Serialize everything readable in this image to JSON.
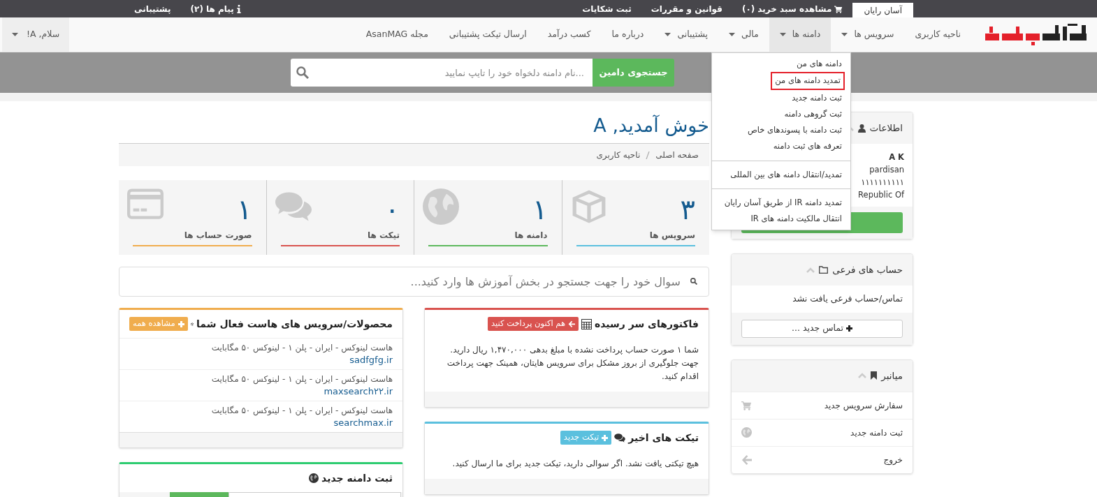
{
  "top_bar": {
    "tabs": [
      {
        "label": "آسان رایان",
        "selected": true
      }
    ],
    "links": [
      {
        "label": "مشاهده سبد خرید (۰)",
        "kind": "cart"
      },
      {
        "label": "قوانین و مقررات",
        "kind": "plain"
      },
      {
        "label": "ثبت شکایات",
        "kind": "plain"
      }
    ],
    "left_links": [
      {
        "label": "پیام ها (۲)",
        "kind": "info"
      },
      {
        "label": "پشتیبانی",
        "kind": "plain"
      }
    ]
  },
  "nav": {
    "items": [
      {
        "label": "ناحیه کاربری",
        "dropdown": false,
        "selected": false
      },
      {
        "label": "سرویس ها",
        "dropdown": true,
        "selected": false
      },
      {
        "label": "دامنه ها",
        "dropdown": true,
        "selected": true
      },
      {
        "label": "مالی",
        "dropdown": true,
        "selected": false
      },
      {
        "label": "پشتیبانی",
        "dropdown": true,
        "selected": false
      },
      {
        "label": "درباره ما",
        "dropdown": false,
        "selected": false
      },
      {
        "label": "کسب درآمد",
        "dropdown": false,
        "selected": false
      },
      {
        "label": "ارسال تیکت پشتیبانی",
        "dropdown": false,
        "selected": false
      },
      {
        "label": "مجله AsanMAG",
        "dropdown": false,
        "selected": false
      }
    ],
    "account": "سلام, A!"
  },
  "dropdown": {
    "items": [
      {
        "kind": "item",
        "label": "دامنه های من",
        "outlined": false
      },
      {
        "kind": "item",
        "label": "تمدید دامنه های من",
        "outlined": true
      },
      {
        "kind": "item",
        "label": "ثبت دامنه جدید",
        "outlined": false
      },
      {
        "kind": "item",
        "label": "ثبت گروهی دامنه",
        "outlined": false
      },
      {
        "kind": "item",
        "label": "ثبت دامنه با پسوندهای خاص",
        "outlined": false
      },
      {
        "kind": "item",
        "label": "تعرفه های ثبت دامنه",
        "outlined": false
      },
      {
        "kind": "divider"
      },
      {
        "kind": "item",
        "label": "تمدید/انتقال دامنه های بین المللی",
        "outlined": false
      },
      {
        "kind": "divider"
      },
      {
        "kind": "item",
        "label": "تمدید دامنه IR از طریق آسان رایان",
        "outlined": false
      },
      {
        "kind": "item",
        "label": "انتقال مالکیت دامنه های IR",
        "outlined": false
      }
    ]
  },
  "domain_search": {
    "placeholder": "...نام دامنه دلخواه خود را تایپ نمایید",
    "button": "جستجوی دامین"
  },
  "page_title": "خوش آمدید, A",
  "breadcrumb": [
    "صفحه اصلی",
    "ناحیه کاربری"
  ],
  "stats": [
    {
      "value": "۳",
      "label": "سرویس ها",
      "color": "#5bc0de",
      "kind": "box"
    },
    {
      "value": "۱",
      "label": "دامنه ها",
      "color": "#5cb85c",
      "kind": "globe"
    },
    {
      "value": "۰",
      "label": "تیکت ها",
      "color": "#d9534f",
      "kind": "chat"
    },
    {
      "value": "۱",
      "label": "صورت حساب ها",
      "color": "#f0ad4e",
      "kind": "card"
    }
  ],
  "kb_search": {
    "placeholder": "سوال خود را جهت جستجو در بخش آموزش ها وارد کنید..."
  },
  "invoices": {
    "title": "فاکتورهای سر رسیده",
    "button": "هم اکنون پرداخت کنید",
    "text": "شما ۱ صورت حساب پرداخت نشده با مبلغ بدهی ۱,۴۷۰,۰۰۰ ریال دارید. جهت جلوگیری از بروز مشکل برای سرویس هایتان، همینک جهت پرداخت اقدام کنید."
  },
  "tickets": {
    "title": "تیکت های اخیر",
    "button": "تیکت جدید",
    "text": "هیچ تیکتی یافت نشد. اگر سوالی دارید، تیکت جدید برای ما ارسال کنید."
  },
  "products": {
    "title": "محصولات/سرویس های هاست فعال شما",
    "button": "مشاهده همه",
    "rows": [
      {
        "name": "هاست لینوکس - ایران - پلن ۱ - لینوکس ۵۰ مگابایت",
        "domain": "sadfgfg.ir"
      },
      {
        "name": "هاست لینوکس - ایران - پلن ۱ - لینوکس ۵۰ مگابایت",
        "domain": "maxsearch۲۲.ir"
      },
      {
        "name": "هاست لینوکس - ایران - پلن ۱ - لینوکس ۵۰ مگابایت",
        "domain": "searchmax.ir"
      }
    ]
  },
  "register_domain": {
    "title": "ثبت دامنه جدید"
  },
  "sidebar": {
    "info": {
      "title": "اطلاعات",
      "lines": [
        "A K",
        "pardisan",
        "۱۱۱۱۱۱۱۱۱۱",
        "Republic Of"
      ]
    },
    "subaccounts": {
      "title": "حساب های فرعی",
      "empty": "تماس/حساب فرعی یافت نشد",
      "button": "تماس جدید ..."
    },
    "shortcuts": {
      "title": "میانبر",
      "items": [
        {
          "label": "سفارش سرویس جدید",
          "kind": "cart"
        },
        {
          "label": "ثبت دامنه جدید",
          "kind": "globe"
        },
        {
          "label": "خروج",
          "kind": "arrow"
        }
      ]
    }
  }
}
